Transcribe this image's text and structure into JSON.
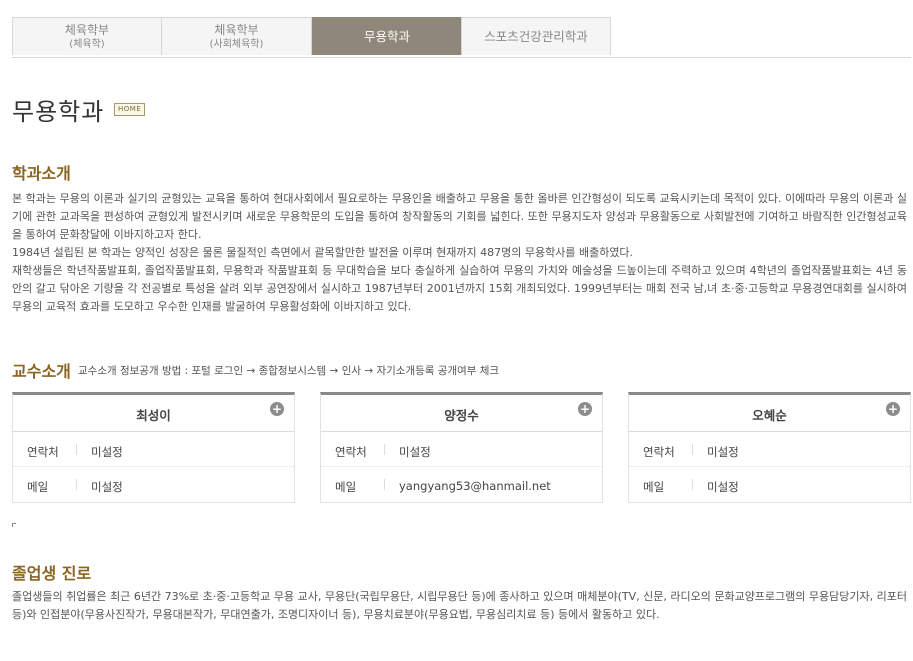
{
  "tabs": [
    {
      "label": "체육학부",
      "sub": "(체육학)",
      "active": false
    },
    {
      "label": "체육학부",
      "sub": "(사회체육학)",
      "active": false
    },
    {
      "label": "무용학과",
      "sub": "",
      "active": true
    },
    {
      "label": "스포츠건강관리학과",
      "sub": "",
      "active": false
    }
  ],
  "page": {
    "title": "무용학과",
    "home_badge": "HOME"
  },
  "intro": {
    "heading": "학과소개",
    "paragraphs": [
      "본 학과는 무용의 이론과 실기의 균형있는 교육을 통하여 현대사회에서 필요로하는 무용인을 배출하고 무용을 통한 올바른 인간형성이 되도록 교육시키는데 목적이 있다. 이에따라 무용의 이론과 실기에 관한 교과목을 편성하여 균형있게 발전시키며 새로운 무용학문의 도입을 통하여 창작활동의 기회를 넓힌다. 또한 무용지도자 양성과 무용활동으로 사회발전에 기여하고 바람직한 인간형성교육을 통하여 문화창달에 이바지하고자 한다.",
      "1984년 설립된 본 학과는 양적인 성장은 물론 물질적인 측면에서 괄목할만한 발전을 이루며 현재까지 487명의 무용학사를 배출하였다.",
      "재학생들은 학년작품발표회, 졸업작품발표회, 무용학과 작품발표회 등 무대학습을 보다 충실하게 실습하여 무용의 가치와 예술성을 드높이는데 주력하고 있으며 4학년의 졸업작품발표회는 4년 동안의 갈고 닦아온 기량을 각 전공별로 특성을 살려 외부 공연장에서 실시하고 1987년부터 2001년까지 15회 개최되었다. 1999년부터는 매회 전국 남,녀 초·중·고등학교 무용경연대회를 실시하여 무용의 교육적 효과를 도모하고 우수한 인재를 발굴하여 무용활성화에 이바지하고 있다."
    ]
  },
  "professors": {
    "heading": "교수소개",
    "note": "교수소개 정보공개 방법 : 포털 로그인 → 종합정보시스템 → 인사 → 자기소개등록 공개여부 체크",
    "contact_label": "연락처",
    "email_label": "메일",
    "cards": [
      {
        "name": "최성이",
        "contact": "미설정",
        "email": "미설정"
      },
      {
        "name": "양정수",
        "contact": "미설정",
        "email": "yangyang53@hanmail.net"
      },
      {
        "name": "오혜순",
        "contact": "미설정",
        "email": "미설정"
      }
    ]
  },
  "career": {
    "heading": "졸업생 진로",
    "text": "졸업생들의 취업률은 최근 6년간 73%로 초·중·고등학교 무용 교사, 무용단(국립무용단, 시립무용단 등)에 종사하고 있으며 매체분야(TV, 신문, 라디오의 문화교양프로그램의 무용담당기자, 리포터 등)와 인접분야(무용사진작가, 무용대본작가, 무대연출가, 조명디자이너 등), 무용치료분야(무용요법, 무용심리치료 등) 등에서 활동하고 있다."
  }
}
